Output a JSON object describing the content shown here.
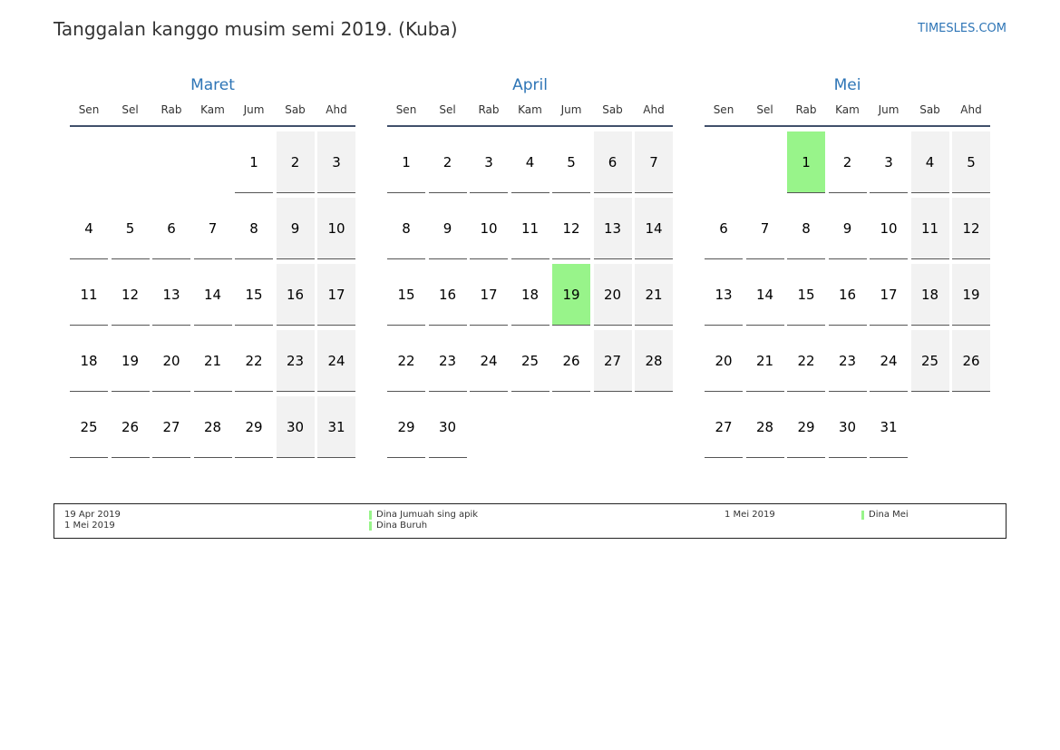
{
  "header": {
    "title": "Tanggalan kanggo musim semi 2019. (Kuba)",
    "site": "TIMESLES.COM"
  },
  "weekdays": [
    "Sen",
    "Sel",
    "Rab",
    "Kam",
    "Jum",
    "Sab",
    "Ahd"
  ],
  "colors": {
    "accent": "#2e75b6",
    "holiday": "#98f48a",
    "weekend": "#f2f2f2"
  },
  "months": [
    {
      "name": "Maret",
      "offset": 4,
      "days": 31,
      "holidays": []
    },
    {
      "name": "April",
      "offset": 0,
      "days": 30,
      "holidays": [
        19
      ]
    },
    {
      "name": "Mei",
      "offset": 2,
      "days": 31,
      "holidays": [
        1
      ]
    }
  ],
  "legend": {
    "left": [
      {
        "date": "19 Apr 2019",
        "name": "Dina Jumuah sing apik"
      },
      {
        "date": "1 Mei 2019",
        "name": "Dina Buruh"
      }
    ],
    "right": [
      {
        "date": "1 Mei 2019",
        "name": "Dina Mei"
      }
    ]
  }
}
